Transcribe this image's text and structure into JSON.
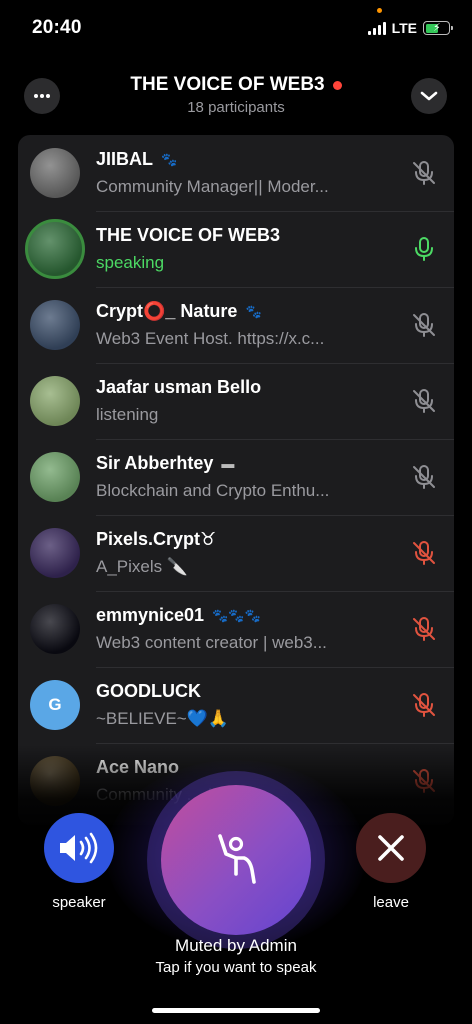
{
  "status": {
    "time": "20:40",
    "network": "LTE",
    "battery_level": 0.55,
    "charging": true
  },
  "header": {
    "title": "THE VOICE OF WEB3",
    "participants": "18 participants",
    "live_color": "#ff453a"
  },
  "participants": [
    {
      "name": "JIIBAL",
      "badge": "🐾",
      "subtitle": "Community Manager|| Moder...",
      "speaking": false,
      "mic": "muted",
      "avatar": "cat-photo",
      "avatar_color": "#6e6e6e"
    },
    {
      "name": "THE VOICE OF WEB3",
      "badge": "",
      "subtitle": "speaking",
      "speaking": true,
      "mic": "on",
      "avatar": "web3-literacy-logo",
      "avatar_color": "#2f6d3a"
    },
    {
      "name": "Crypt⭕_ Nature",
      "badge": "🐾",
      "subtitle": "Web3 Event Host. https://x.c...",
      "speaking": false,
      "mic": "muted",
      "avatar": "desk-setup-photo",
      "avatar_color": "#3c4f6b"
    },
    {
      "name": "Jaafar usman Bello",
      "badge": "",
      "subtitle": "listening",
      "speaking": false,
      "mic": "muted",
      "avatar": "person-photo",
      "avatar_color": "#8aa86d"
    },
    {
      "name": "Sir Abberhtey",
      "badge": "▬",
      "subtitle": "Blockchain and Crypto Enthu...",
      "speaking": false,
      "mic": "muted",
      "avatar": "cartoon-avatar",
      "avatar_color": "#6fa36a"
    },
    {
      "name": "Pixels.Crypt♉",
      "badge": "",
      "subtitle": "A_Pixels 🔪",
      "speaking": false,
      "mic": "muted-by-admin",
      "avatar": "panda-art",
      "avatar_color": "#3a2a5e"
    },
    {
      "name": "emmynice01",
      "badge": "🐾🐾🐾",
      "subtitle": "Web3 content creator | web3...",
      "speaking": false,
      "mic": "muted-by-admin",
      "avatar": "sigma-logo",
      "avatar_color": "#0b0b14"
    },
    {
      "name": "GOODLUCK",
      "badge": "",
      "subtitle": "~BELIEVE~💙🙏",
      "speaking": false,
      "mic": "muted-by-admin",
      "avatar": "letter-avatar",
      "avatar_letter": "G",
      "avatar_color": "#5aa7e6"
    },
    {
      "name": "Ace Nano",
      "badge": "",
      "subtitle": "Community ... Ambas...",
      "speaking": false,
      "mic": "muted-by-admin",
      "avatar": "dark-art",
      "avatar_color": "#4a3a1c"
    }
  ],
  "controls": {
    "speaker_label": "speaker",
    "leave_label": "leave",
    "muted_title": "Muted by Admin",
    "muted_hint": "Tap if you want to speak",
    "speaker_color": "#2f55e0",
    "leave_color": "#4a1e1e"
  },
  "colors": {
    "mic_muted": "#8e8e93",
    "mic_admin_muted": "#e0533f",
    "mic_on": "#4cd964"
  }
}
